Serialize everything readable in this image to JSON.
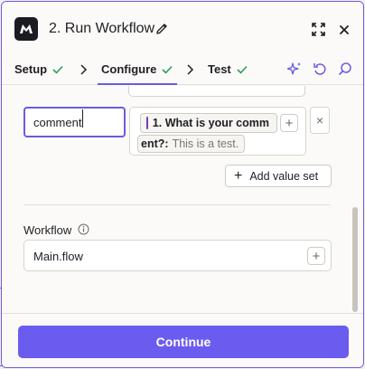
{
  "header": {
    "title": "2. Run Workflow"
  },
  "tabs": [
    {
      "label": "Setup",
      "status": "complete"
    },
    {
      "label": "Configure",
      "status": "complete",
      "active": true
    },
    {
      "label": "Test",
      "status": "complete"
    }
  ],
  "mapping": {
    "key_value": "comment",
    "value_pill_line1": "1. What is your comm",
    "value_pill_line2_bold": "ent?:",
    "value_pill_line2_value": "This is a test.",
    "remove_label": "×",
    "add_value_set_label": "Add value set"
  },
  "workflow": {
    "label": "Workflow",
    "value": "Main.flow"
  },
  "footer": {
    "continue_label": "Continue"
  },
  "colors": {
    "accent": "#6a5ce0",
    "check": "#2e9c5b",
    "button": "#6b5cf0",
    "form_icon": "#7a3db8"
  }
}
